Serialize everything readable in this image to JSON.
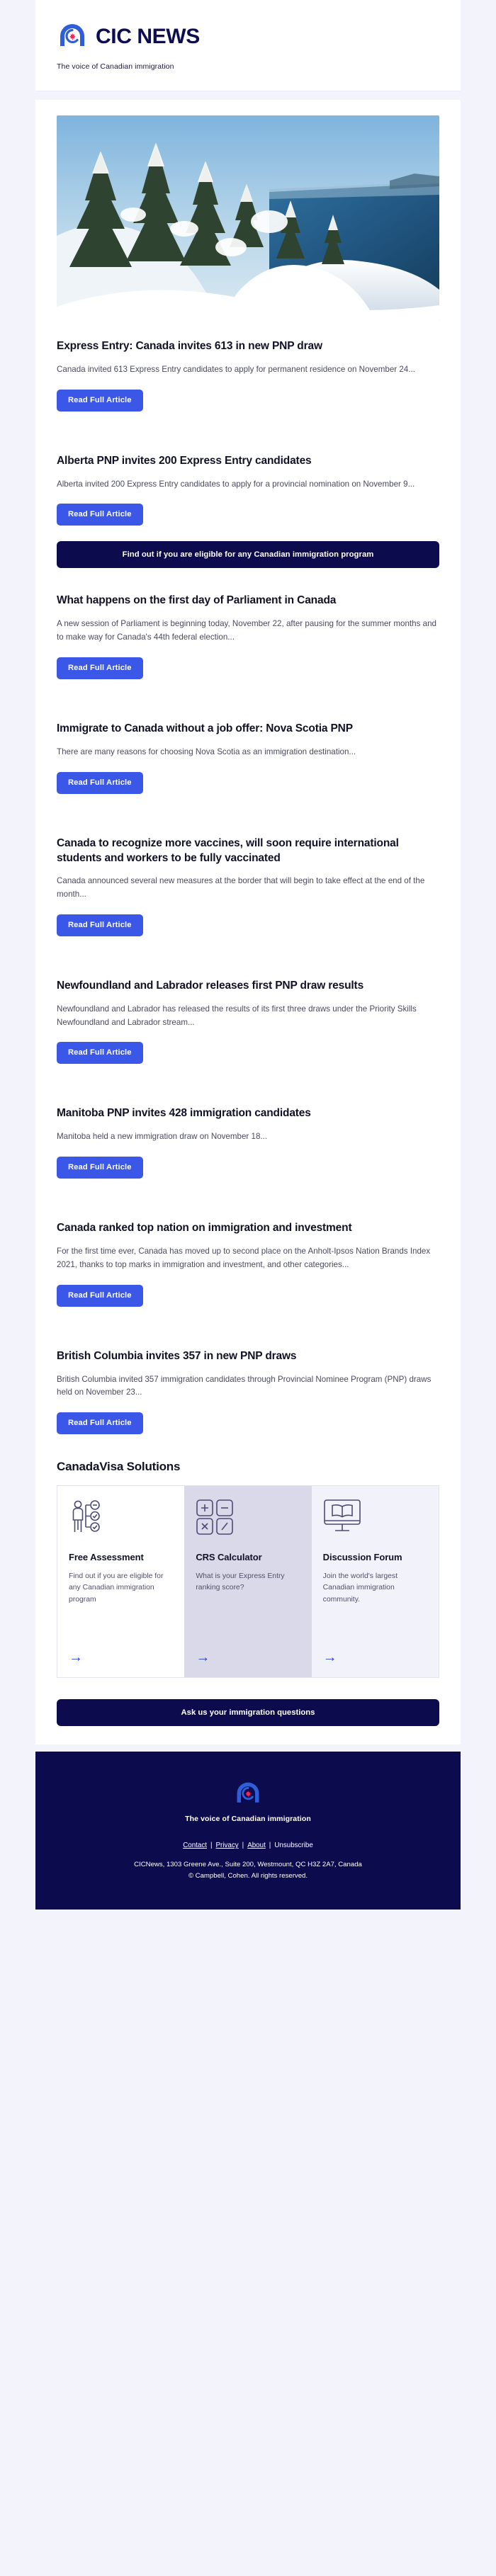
{
  "header": {
    "brand_name": "CIC NEWS",
    "tagline": "The voice of Canadian immigration",
    "logo_icon": "cic-news-circle-maple-leaf-logo"
  },
  "colors": {
    "accent_blue": "#3a57e8",
    "dark_navy": "#0b0b4d",
    "page_bg": "#f3f3fb",
    "card_bg": "#ffffff",
    "arrow_blue": "#2f44cf",
    "maple_red": "#f5265e"
  },
  "hero": {
    "alt": "snow-covered evergreen trees on a mountain ridge overlooking a blue lake",
    "name": "hero-image"
  },
  "read_button_label": "Read Full Article",
  "articles": [
    {
      "title": "Express Entry: Canada invites 613 in new PNP draw",
      "excerpt": "Canada invited 613 Express Entry candidates to apply for permanent residence on November 24...",
      "button": "Read Full Article"
    },
    {
      "title": "Alberta PNP invites 200 Express Entry candidates",
      "excerpt": "Alberta invited 200 Express Entry candidates to apply for a provincial nomination on November 9...",
      "button": "Read Full Article"
    },
    {
      "title": "What happens on the first day of Parliament in Canada",
      "excerpt": "A new session of Parliament is beginning today, November 22, after pausing for the summer months and to make way for Canada's 44th federal election...",
      "button": "Read Full Article"
    },
    {
      "title": "Immigrate to Canada without a job offer: Nova Scotia PNP",
      "excerpt": "There are many reasons for choosing Nova Scotia as an immigration destination...",
      "button": "Read Full Article"
    },
    {
      "title": "Canada to recognize more vaccines, will soon require international students and workers to be fully vaccinated",
      "excerpt": "Canada announced several new measures at the border that will begin to take effect at the end of the month...",
      "button": "Read Full Article"
    },
    {
      "title": "Newfoundland and Labrador releases first PNP draw results",
      "excerpt": "Newfoundland and Labrador has released the results of its first three draws under the Priority Skills Newfoundland and Labrador stream...",
      "button": "Read Full Article"
    },
    {
      "title": "Manitoba PNP invites 428 immigration candidates",
      "excerpt": "Manitoba held a new immigration draw on November 18...",
      "button": "Read Full Article"
    },
    {
      "title": "Canada ranked top nation on immigration and investment",
      "excerpt": "For the first time ever, Canada has moved up to second place on the Anholt-Ipsos Nation Brands Index 2021, thanks to top marks in immigration and investment, and other categories...",
      "button": "Read Full Article"
    },
    {
      "title": "British Columbia invites 357 in new PNP draws",
      "excerpt": "British Columbia invited 357 immigration candidates through Provincial Nominee Program (PNP) draws held on November 23...",
      "button": "Read Full Article"
    }
  ],
  "eligibility_banner": {
    "label": "Find out if you are eligible for any Canadian immigration program"
  },
  "solutions": {
    "title": "CanadaVisa Solutions",
    "cards": [
      {
        "name": "Free Assessment",
        "description": "Find out if you are eligible for any Canadian immigration program",
        "icon": "person-checklist-icon",
        "arrow": "→"
      },
      {
        "name": "CRS Calculator",
        "description": "What is your Express Entry ranking score?",
        "icon": "calculator-operators-icon",
        "arrow": "→"
      },
      {
        "name": "Discussion Forum",
        "description": "Join the world's largest Canadian immigration community.",
        "icon": "monitor-open-book-icon",
        "arrow": "→"
      }
    ]
  },
  "ask_banner": {
    "label": "Ask us your immigration questions"
  },
  "footer": {
    "logo_icon": "cic-news-circle-maple-leaf-logo",
    "tagline": "The voice of Canadian immigration",
    "links": [
      {
        "label": "Contact",
        "underline": true
      },
      {
        "label": "Privacy",
        "underline": true
      },
      {
        "label": "About",
        "underline": true
      },
      {
        "label": "Unsubscribe",
        "underline": false
      }
    ],
    "separator": "|",
    "address": "CICNews, 1303 Greene Ave., Suite 200, Westmount, QC H3Z 2A7, Canada",
    "copyright": "© Campbell, Cohen. All rights reserved."
  }
}
